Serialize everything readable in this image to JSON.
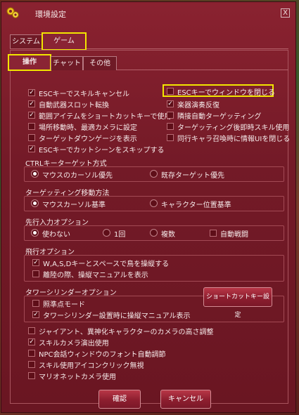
{
  "window": {
    "title": "環境設定",
    "close": "X"
  },
  "tabs_top": [
    {
      "label": "システム"
    },
    {
      "label": "ゲーム"
    }
  ],
  "tabs_sub": [
    {
      "label": "操作"
    },
    {
      "label": "チャット"
    },
    {
      "label": "その他"
    }
  ],
  "checks_left": [
    {
      "label": "ESCキーでスキルキャンセル",
      "checked": true
    },
    {
      "label": "自動武器スロット転換",
      "checked": true
    },
    {
      "label": "範囲アイテムをショートカットキーで使用",
      "checked": true
    },
    {
      "label": "場所移動時、最適カメラに設定",
      "checked": false
    },
    {
      "label": "ターゲットダウンゲージを表示",
      "checked": false
    },
    {
      "label": "ESCキーでカットシーンをスキップする",
      "checked": true
    }
  ],
  "checks_right": [
    {
      "label": "ESCキーでウィンドウを閉じる",
      "checked": false
    },
    {
      "label": "楽器演奏反復",
      "checked": true
    },
    {
      "label": "隣接自動ターゲッティング",
      "checked": false
    },
    {
      "label": "ターゲッティング後即時スキル使用",
      "checked": false
    },
    {
      "label": "同行キャラ召喚時に情報UIを閉じる",
      "checked": false
    }
  ],
  "ctrl_target": {
    "title": "CTRLキーターゲット方式",
    "options": [
      "マウスのカーソル優先",
      "既存ターゲット優先"
    ],
    "selected": 0
  },
  "targeting_move": {
    "title": "ターゲッティング移動方法",
    "options": [
      "マウスカーソル基準",
      "キャラクター位置基準"
    ],
    "selected": 0
  },
  "preinput": {
    "title": "先行入力オプション",
    "options": [
      "使わない",
      "1回",
      "複数"
    ],
    "selected": 0,
    "auto_label": "自動戦闘",
    "auto_checked": false
  },
  "flight": {
    "title": "飛行オプション",
    "items": [
      {
        "label": "W,A,S,Dキーとスペースで鳥を操縦する",
        "checked": true
      },
      {
        "label": "離陸の際、操縦マニュアルを表示",
        "checked": false
      }
    ]
  },
  "tower": {
    "title": "タワーシリンダーオプション",
    "items": [
      {
        "label": "照準点モード",
        "checked": false
      },
      {
        "label": "タワーシリンダー設置時に操縦マニュアル表示",
        "checked": true
      }
    ],
    "shortcut_button": "ショートカットキー設定"
  },
  "misc": [
    {
      "label": "ジャイアント、異神化キャラクターのカメラの高さ調整",
      "checked": false
    },
    {
      "label": "スキルカメラ演出使用",
      "checked": true
    },
    {
      "label": "NPC会話ウィンドウのフォント自動調節",
      "checked": false
    },
    {
      "label": "スキル使用アイコンクリック無視",
      "checked": false
    },
    {
      "label": "マリオネットカメラ使用",
      "checked": false
    }
  ],
  "footer": {
    "ok": "確認",
    "cancel": "キャンセル"
  },
  "colors": {
    "window": "#7a1e2a",
    "highlight": "#f2e600",
    "button": "#b83747"
  },
  "icons": {
    "title": "gear-icon"
  }
}
